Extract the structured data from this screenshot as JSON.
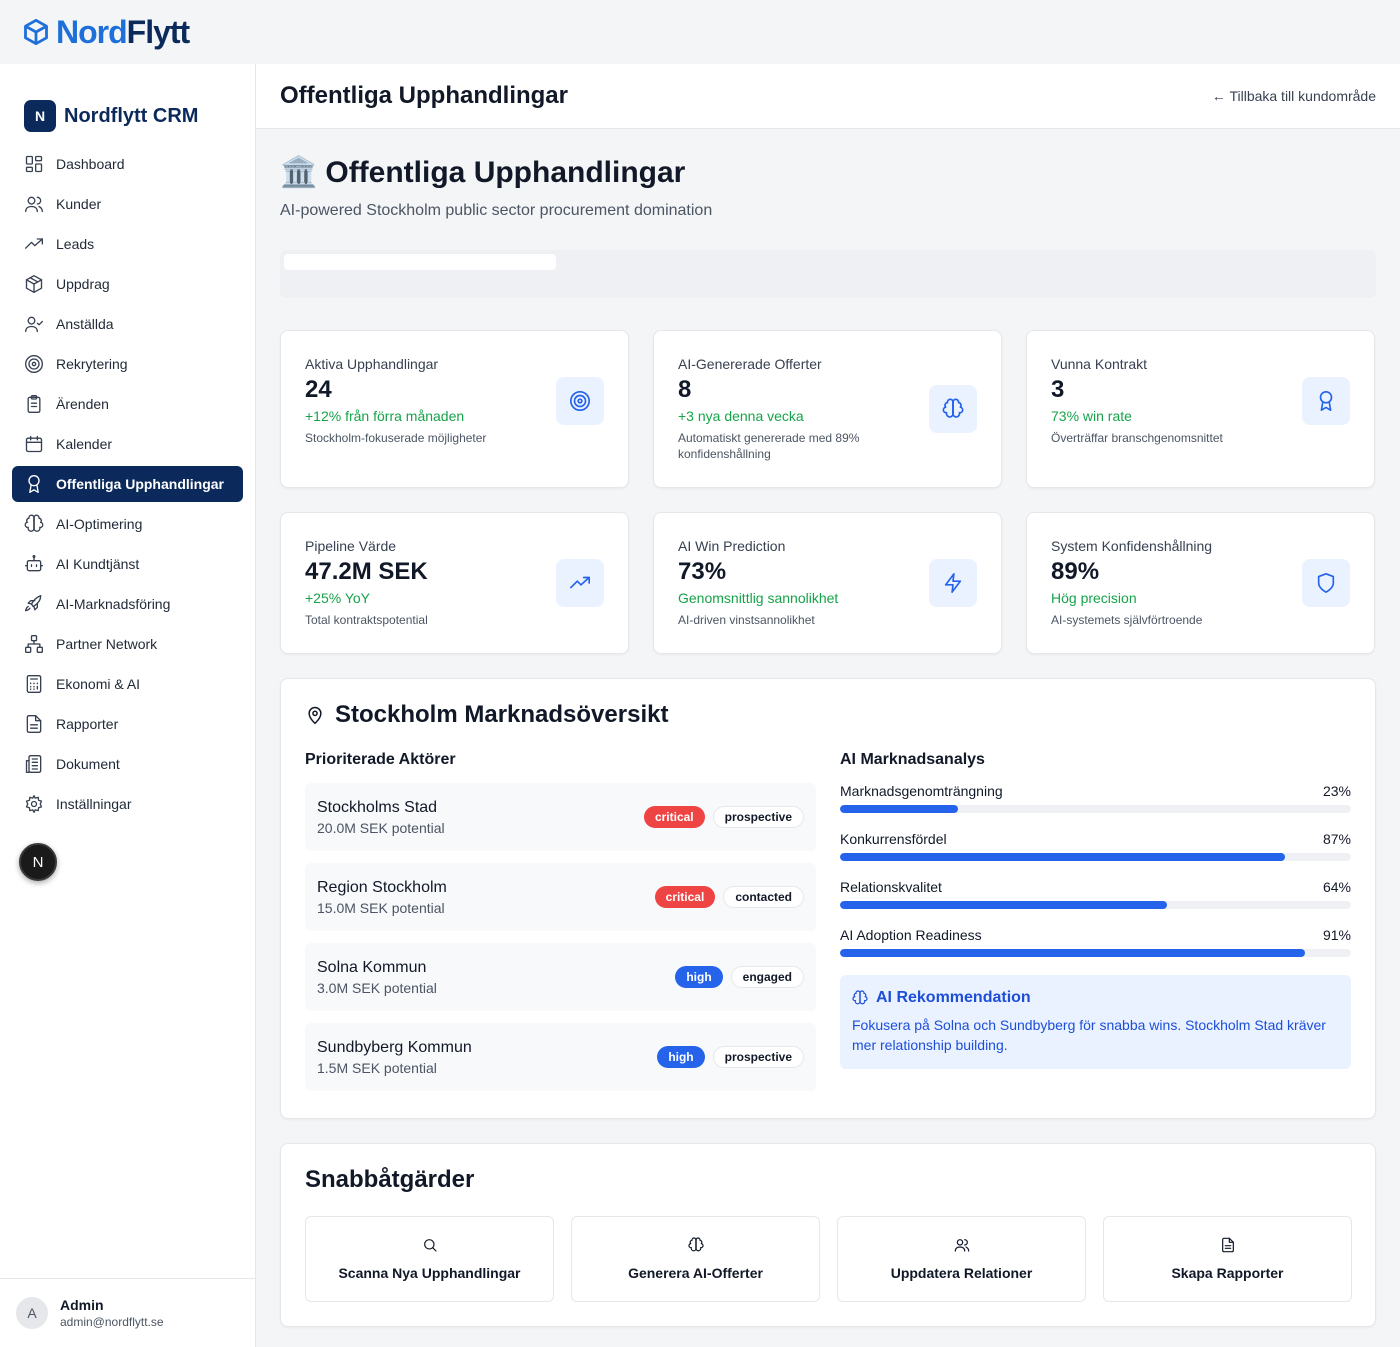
{
  "brand": {
    "part1": "Nord",
    "part2": "Flytt"
  },
  "sidebar": {
    "badge": "N",
    "title": "Nordflytt CRM",
    "items": [
      {
        "label": "Dashboard",
        "icon": "grid-icon",
        "active": false
      },
      {
        "label": "Kunder",
        "icon": "users-icon",
        "active": false
      },
      {
        "label": "Leads",
        "icon": "trending-up-icon",
        "active": false
      },
      {
        "label": "Uppdrag",
        "icon": "box-icon",
        "active": false
      },
      {
        "label": "Anställda",
        "icon": "user-check-icon",
        "active": false
      },
      {
        "label": "Rekrytering",
        "icon": "target-icon",
        "active": false
      },
      {
        "label": "Ärenden",
        "icon": "clipboard-icon",
        "active": false
      },
      {
        "label": "Kalender",
        "icon": "calendar-icon",
        "active": false
      },
      {
        "label": "Offentliga Upphandlingar",
        "icon": "award-icon",
        "active": true
      },
      {
        "label": "AI-Optimering",
        "icon": "brain-icon",
        "active": false
      },
      {
        "label": "AI Kundtjänst",
        "icon": "bot-icon",
        "active": false
      },
      {
        "label": "AI-Marknadsföring",
        "icon": "rocket-icon",
        "active": false
      },
      {
        "label": "Partner Network",
        "icon": "network-icon",
        "active": false
      },
      {
        "label": "Ekonomi & AI",
        "icon": "calculator-icon",
        "active": false
      },
      {
        "label": "Rapporter",
        "icon": "file-text-icon",
        "active": false
      },
      {
        "label": "Dokument",
        "icon": "files-icon",
        "active": false
      },
      {
        "label": "Inställningar",
        "icon": "settings-icon",
        "active": false
      }
    ],
    "fab": "N",
    "user": {
      "initial": "A",
      "name": "Admin",
      "email": "admin@nordflytt.se"
    }
  },
  "header": {
    "title": "Offentliga Upphandlingar",
    "back": "← Tillbaka till kundområde"
  },
  "page": {
    "emoji": "🏛️",
    "title": "Offentliga Upphandlingar",
    "subtitle": "AI-powered Stockholm public sector procurement domination"
  },
  "stats": [
    {
      "label": "Aktiva Upphandlingar",
      "value": "24",
      "delta": "+12% från förra månaden",
      "desc": "Stockholm-fokuserade möjligheter",
      "icon": "target-icon"
    },
    {
      "label": "AI-Genererade Offerter",
      "value": "8",
      "delta": "+3 nya denna vecka",
      "desc": "Automatiskt genererade med 89% konfidenshållning",
      "icon": "brain-icon"
    },
    {
      "label": "Vunna Kontrakt",
      "value": "3",
      "delta": "73% win rate",
      "desc": "Överträffar branschgenomsnittet",
      "icon": "award-icon"
    },
    {
      "label": "Pipeline Värde",
      "value": "47.2M SEK",
      "delta": "+25% YoY",
      "desc": "Total kontraktspotential",
      "icon": "trending-up-icon"
    },
    {
      "label": "AI Win Prediction",
      "value": "73%",
      "delta": "Genomsnittlig sannolikhet",
      "desc": "AI-driven vinstsannolikhet",
      "icon": "zap-icon"
    },
    {
      "label": "System Konfidenshållning",
      "value": "89%",
      "delta": "Hög precision",
      "desc": "AI-systemets självförtroende",
      "icon": "shield-icon"
    }
  ],
  "market": {
    "title": "Stockholm Marknadsöversikt",
    "actors_heading": "Prioriterade Aktörer",
    "actors": [
      {
        "name": "Stockholms Stad",
        "potential": "20.0M SEK potential",
        "priority": "critical",
        "status": "prospective"
      },
      {
        "name": "Region Stockholm",
        "potential": "15.0M SEK potential",
        "priority": "critical",
        "status": "contacted"
      },
      {
        "name": "Solna Kommun",
        "potential": "3.0M SEK potential",
        "priority": "high",
        "status": "engaged"
      },
      {
        "name": "Sundbyberg Kommun",
        "potential": "1.5M SEK potential",
        "priority": "high",
        "status": "prospective"
      }
    ],
    "analysis_heading": "AI Marknadsanalys",
    "metrics": [
      {
        "label": "Marknadsgenomträngning",
        "value": "23%",
        "fraction": 0.23
      },
      {
        "label": "Konkurrensfördel",
        "value": "87%",
        "fraction": 0.87
      },
      {
        "label": "Relationskvalitet",
        "value": "64%",
        "fraction": 0.64
      },
      {
        "label": "AI Adoption Readiness",
        "value": "91%",
        "fraction": 0.91
      }
    ],
    "recommendation": {
      "title": "AI Rekommendation",
      "text": "Fokusera på Solna och Sundbyberg för snabba wins. Stockholm Stad kräver mer relationship building."
    }
  },
  "quick_actions": {
    "title": "Snabbåtgärder",
    "items": [
      {
        "label": "Scanna Nya Upphandlingar",
        "icon": "search-icon"
      },
      {
        "label": "Generera AI-Offerter",
        "icon": "brain-icon"
      },
      {
        "label": "Uppdatera Relationer",
        "icon": "users-icon"
      },
      {
        "label": "Skapa Rapporter",
        "icon": "file-text-icon"
      }
    ]
  },
  "colors": {
    "navy": "#0b2a5b",
    "accent": "#2563eb",
    "positive": "#16a34a",
    "critical": "#ef4444"
  }
}
